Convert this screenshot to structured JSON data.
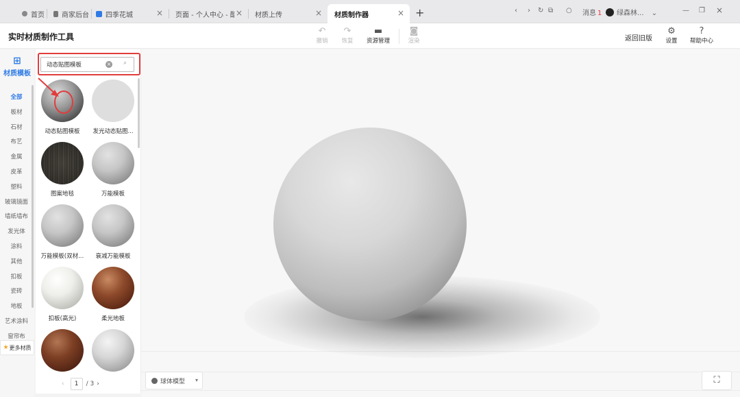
{
  "browser": {
    "tabs": [
      {
        "label": "首页",
        "icon": "home-icon"
      },
      {
        "label": "商家后台",
        "icon": "page-icon"
      },
      {
        "label": "四季花城",
        "icon": "site-icon"
      },
      {
        "label": "页面 - 个人中心 - 酷",
        "icon": "page-icon"
      },
      {
        "label": "材质上传",
        "icon": "page-icon"
      },
      {
        "label": "材质制作器",
        "icon": "page-icon"
      }
    ],
    "messages_label": "消息",
    "messages_count": "1",
    "user_name": "绿森林..."
  },
  "header": {
    "title": "实时材质制作工具",
    "tools": [
      {
        "label": "撤销",
        "icon": "undo-icon",
        "disabled": true
      },
      {
        "label": "恢复",
        "icon": "redo-icon",
        "disabled": true
      },
      {
        "label": "资源管理",
        "icon": "folder-icon",
        "disabled": false
      },
      {
        "label": "渲染",
        "icon": "camera-icon",
        "disabled": true
      }
    ],
    "back_old": "返回旧版",
    "settings": "设置",
    "help": "帮助中心"
  },
  "rail": {
    "title": "材质模板",
    "categories": [
      "全部",
      "板材",
      "石材",
      "布艺",
      "金属",
      "皮革",
      "塑料",
      "玻璃镜面",
      "墙纸墙布",
      "发光体",
      "涂料",
      "其他",
      "扣板",
      "瓷砖",
      "地板",
      "艺术涂料",
      "窗帘布"
    ],
    "active_index": 0,
    "more": "更多材质"
  },
  "panel": {
    "search_value": "动态贴图模板",
    "materials": [
      {
        "label": "动态贴图模板",
        "style": "dark-gloss"
      },
      {
        "label": "发光动态贴图...",
        "style": "flat-light"
      },
      {
        "label": "图案地毯",
        "style": "fabric"
      },
      {
        "label": "万能模板",
        "style": "grey"
      },
      {
        "label": "万能模板(双材...",
        "style": "grey"
      },
      {
        "label": "衰减万能模板",
        "style": "grey"
      },
      {
        "label": "扣板(高光)",
        "style": "white-tile"
      },
      {
        "label": "柔光地板",
        "style": "wood"
      },
      {
        "label": "",
        "style": "wood-dark"
      },
      {
        "label": "",
        "style": "grey-tile"
      }
    ],
    "page_current": "1",
    "page_total": "3"
  },
  "viewport": {
    "model_select": "球体模型"
  }
}
